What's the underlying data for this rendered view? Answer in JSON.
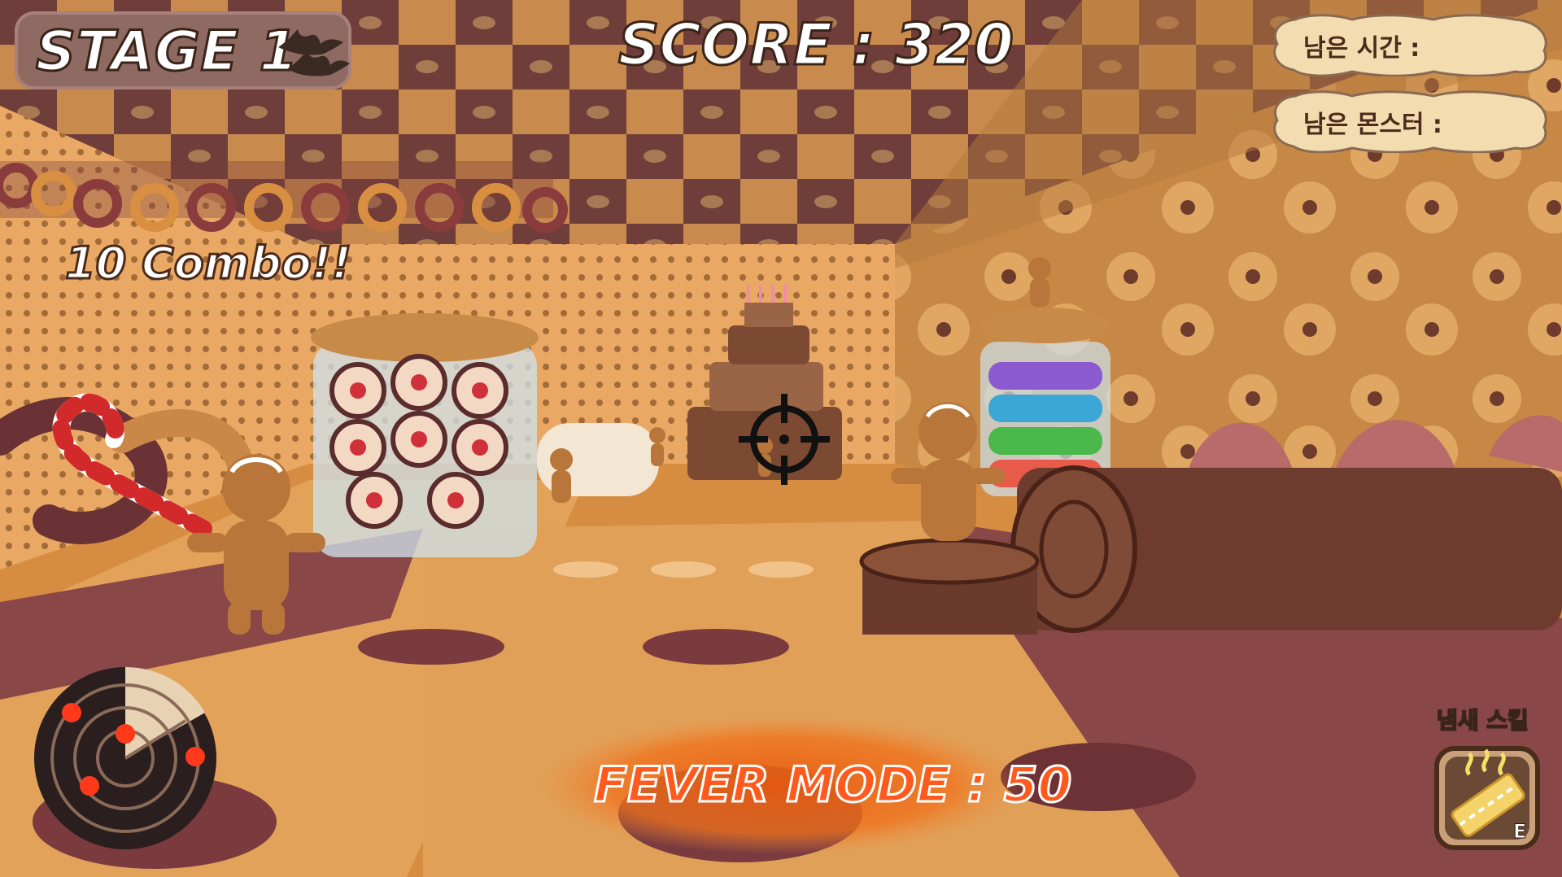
{
  "hud": {
    "stage_label": "STAGE 1",
    "score_text": "SCORE : 320",
    "combo_text": "10 Combo!!",
    "time_label": "남은 시간 :",
    "monster_label": "남은 몬스터 :",
    "fever_text": "FEVER MODE : 50",
    "skill_label": "냄새 스킬",
    "skill_key": "E"
  },
  "icons": {
    "stage": "bat-icon",
    "crosshair": "crosshair-icon",
    "radar": "radar-icon",
    "skill": "smell-skill-icon"
  },
  "colors": {
    "fever": "#ff5a1e",
    "hud_cloud": "#f3dcb0",
    "radar_blip": "#ff3a1a"
  }
}
